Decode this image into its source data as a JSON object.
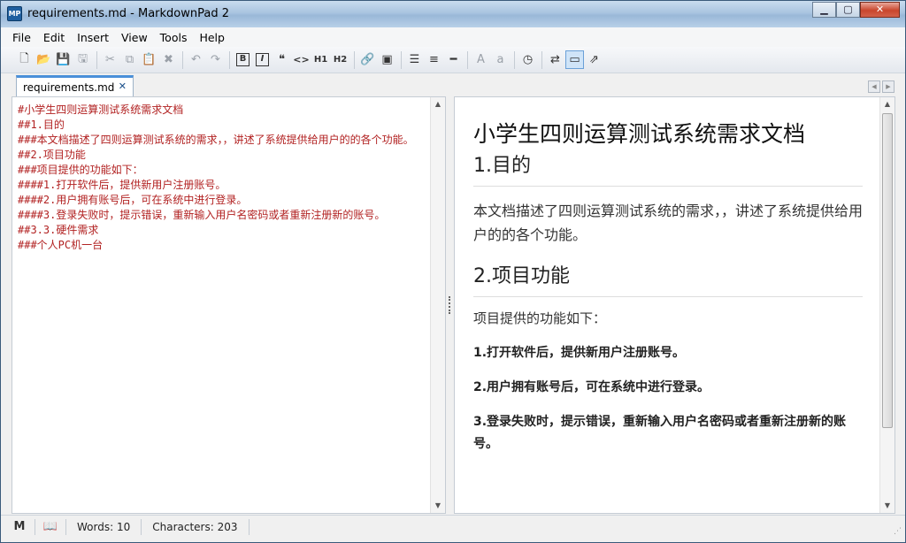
{
  "window": {
    "title": "requirements.md - MarkdownPad 2",
    "app_icon": "MP"
  },
  "menu": [
    "File",
    "Edit",
    "Insert",
    "View",
    "Tools",
    "Help"
  ],
  "toolbar": {
    "bold": "B",
    "italic": "I",
    "quote": "❝",
    "code": "<>",
    "h1": "H1",
    "h2": "H2",
    "font_large": "A",
    "font_small": "a"
  },
  "tab": {
    "label": "requirements.md",
    "close": "✕"
  },
  "editor": {
    "content": "#小学生四则运算测试系统需求文档\n##1.目的\n###本文档描述了四则运算测试系统的需求，，讲述了系统提供给用户的的各个功能。\n##2.项目功能\n###项目提供的功能如下：\n####1.打开软件后，提供新用户注册账号。\n####2.用户拥有账号后，可在系统中进行登录。\n####3.登录失败时，提示错误，重新输入用户名密码或者重新注册新的账号。\n##3.3.硬件需求\n###个人PC机一台"
  },
  "preview": {
    "h1": "小学生四则运算测试系统需求文档",
    "h2_purpose": "1.目的",
    "p_purpose": "本文档描述了四则运算测试系统的需求，，讲述了系统提供给用户的的各个功能。",
    "h2_features": "2.项目功能",
    "h3_features": "项目提供的功能如下：",
    "h4_1": "1.打开软件后，提供新用户注册账号。",
    "h4_2": "2.用户拥有账号后，可在系统中进行登录。",
    "h4_3": "3.登录失败时，提示错误，重新输入用户名密码或者重新注册新的账号。"
  },
  "status": {
    "words": "Words: 10",
    "characters": "Characters: 203"
  },
  "colors": {
    "editor_text": "#b22222",
    "tab_accent": "#4a90d9"
  }
}
